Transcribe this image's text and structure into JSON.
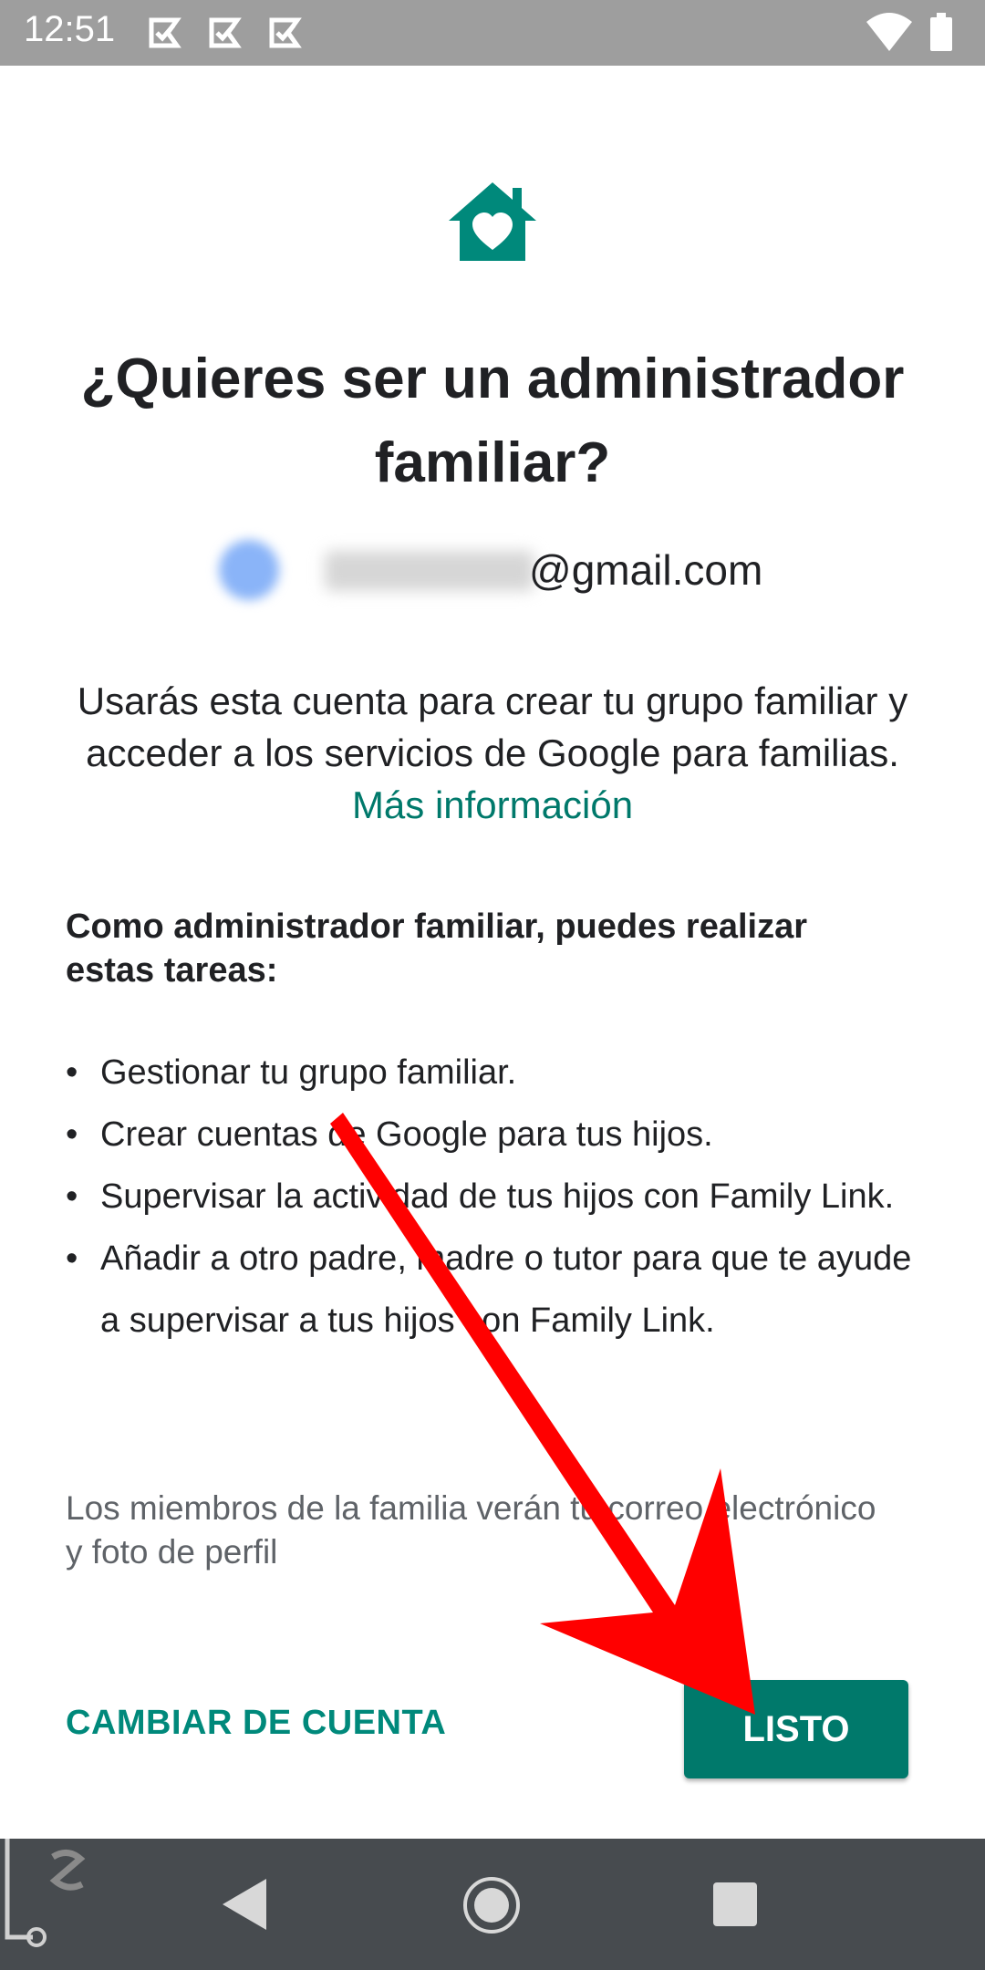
{
  "status_bar": {
    "time": "12:51",
    "icons": [
      "notification-icon",
      "notification-icon",
      "notification-icon",
      "wifi-icon",
      "battery-icon"
    ]
  },
  "header": {
    "icon": "family-home-icon",
    "title": "¿Quieres ser un administrador familiar?"
  },
  "account": {
    "email_suffix": "@gmail.com"
  },
  "description": {
    "text": "Usarás esta cuenta para crear tu grupo familiar y acceder a los servicios de Google para familias.",
    "link": "Más información"
  },
  "tasks": {
    "heading": "Como administrador familiar, puedes realizar estas tareas:",
    "items": [
      "Gestionar tu grupo familiar.",
      "Crear cuentas de Google para tus hijos.",
      "Supervisar la actividad de tus hijos con Family Link.",
      "Añadir a otro padre, madre o tutor para que te ayude a supervisar a tus hijos con Family Link."
    ],
    "bullet": "•"
  },
  "footnote": "Los miembros de la familia verán tu correo electrónico y foto de perfil",
  "actions": {
    "switch_account": "CAMBIAR DE CUENTA",
    "done": "LISTO"
  },
  "colors": {
    "accent": "#00796b",
    "annotation_arrow": "#ff0000",
    "status_bar": "#9e9e9e",
    "nav_bar": "#474b4f"
  }
}
